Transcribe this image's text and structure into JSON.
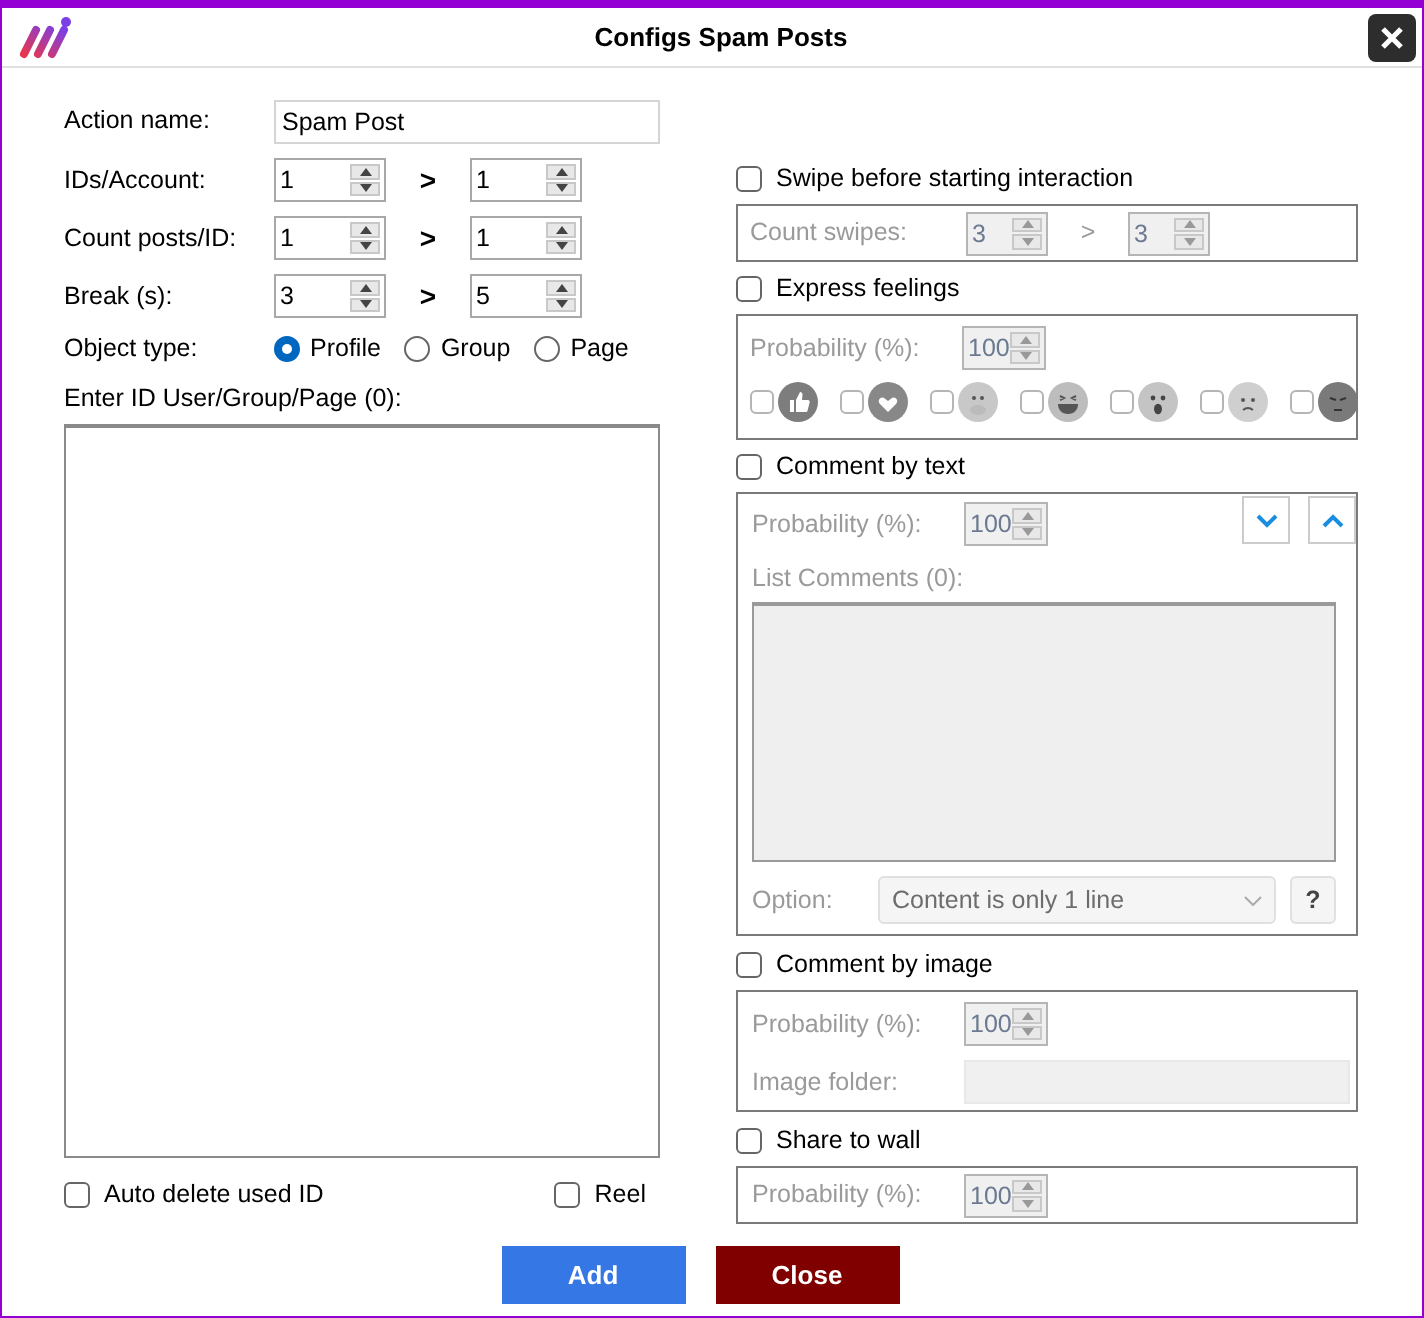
{
  "window": {
    "title": "Configs Spam Posts"
  },
  "action_name": {
    "label": "Action name:",
    "value": "Spam Post"
  },
  "ranges": [
    {
      "label": "IDs/Account:",
      "from": "1",
      "separator": ">",
      "to": "1"
    },
    {
      "label": "Count posts/ID:",
      "from": "1",
      "separator": ">",
      "to": "1"
    },
    {
      "label": "Break (s):",
      "from": "3",
      "separator": ">",
      "to": "5"
    }
  ],
  "object_type": {
    "label": "Object type:",
    "options": [
      {
        "label": "Profile",
        "selected": true
      },
      {
        "label": "Group",
        "selected": false
      },
      {
        "label": "Page",
        "selected": false
      }
    ]
  },
  "id_list": {
    "label": "Enter ID User/Group/Page (0):"
  },
  "auto_delete": {
    "label": "Auto delete used ID",
    "checked": false
  },
  "reel": {
    "label": "Reel",
    "checked": false
  },
  "swipe": {
    "label": "Swipe before starting interaction",
    "checked": false,
    "count_label": "Count swipes:",
    "from": "3",
    "separator": ">",
    "to": "3"
  },
  "express_feelings": {
    "label": "Express feelings",
    "checked": false,
    "probability_label": "Probability (%):",
    "probability": "100",
    "reactions": [
      {
        "kind": "like",
        "checked": false
      },
      {
        "kind": "love",
        "checked": false
      },
      {
        "kind": "care",
        "checked": false
      },
      {
        "kind": "haha",
        "checked": false
      },
      {
        "kind": "wow",
        "checked": false
      },
      {
        "kind": "sad",
        "checked": false
      },
      {
        "kind": "angry",
        "checked": false
      }
    ]
  },
  "comment_text": {
    "label": "Comment by text",
    "checked": false,
    "probability_label": "Probability (%):",
    "probability": "100",
    "list_label": "List Comments (0):",
    "option_label": "Option:",
    "option_value": "Content is only 1 line",
    "help": "?"
  },
  "comment_image": {
    "label": "Comment by image",
    "checked": false,
    "probability_label": "Probability (%):",
    "probability": "100",
    "folder_label": "Image folder:"
  },
  "share_wall": {
    "label": "Share to wall",
    "checked": false,
    "probability_label": "Probability (%):",
    "probability": "100"
  },
  "buttons": [
    {
      "label": "Add",
      "kind": "primary"
    },
    {
      "label": "Close",
      "kind": "danger"
    }
  ]
}
